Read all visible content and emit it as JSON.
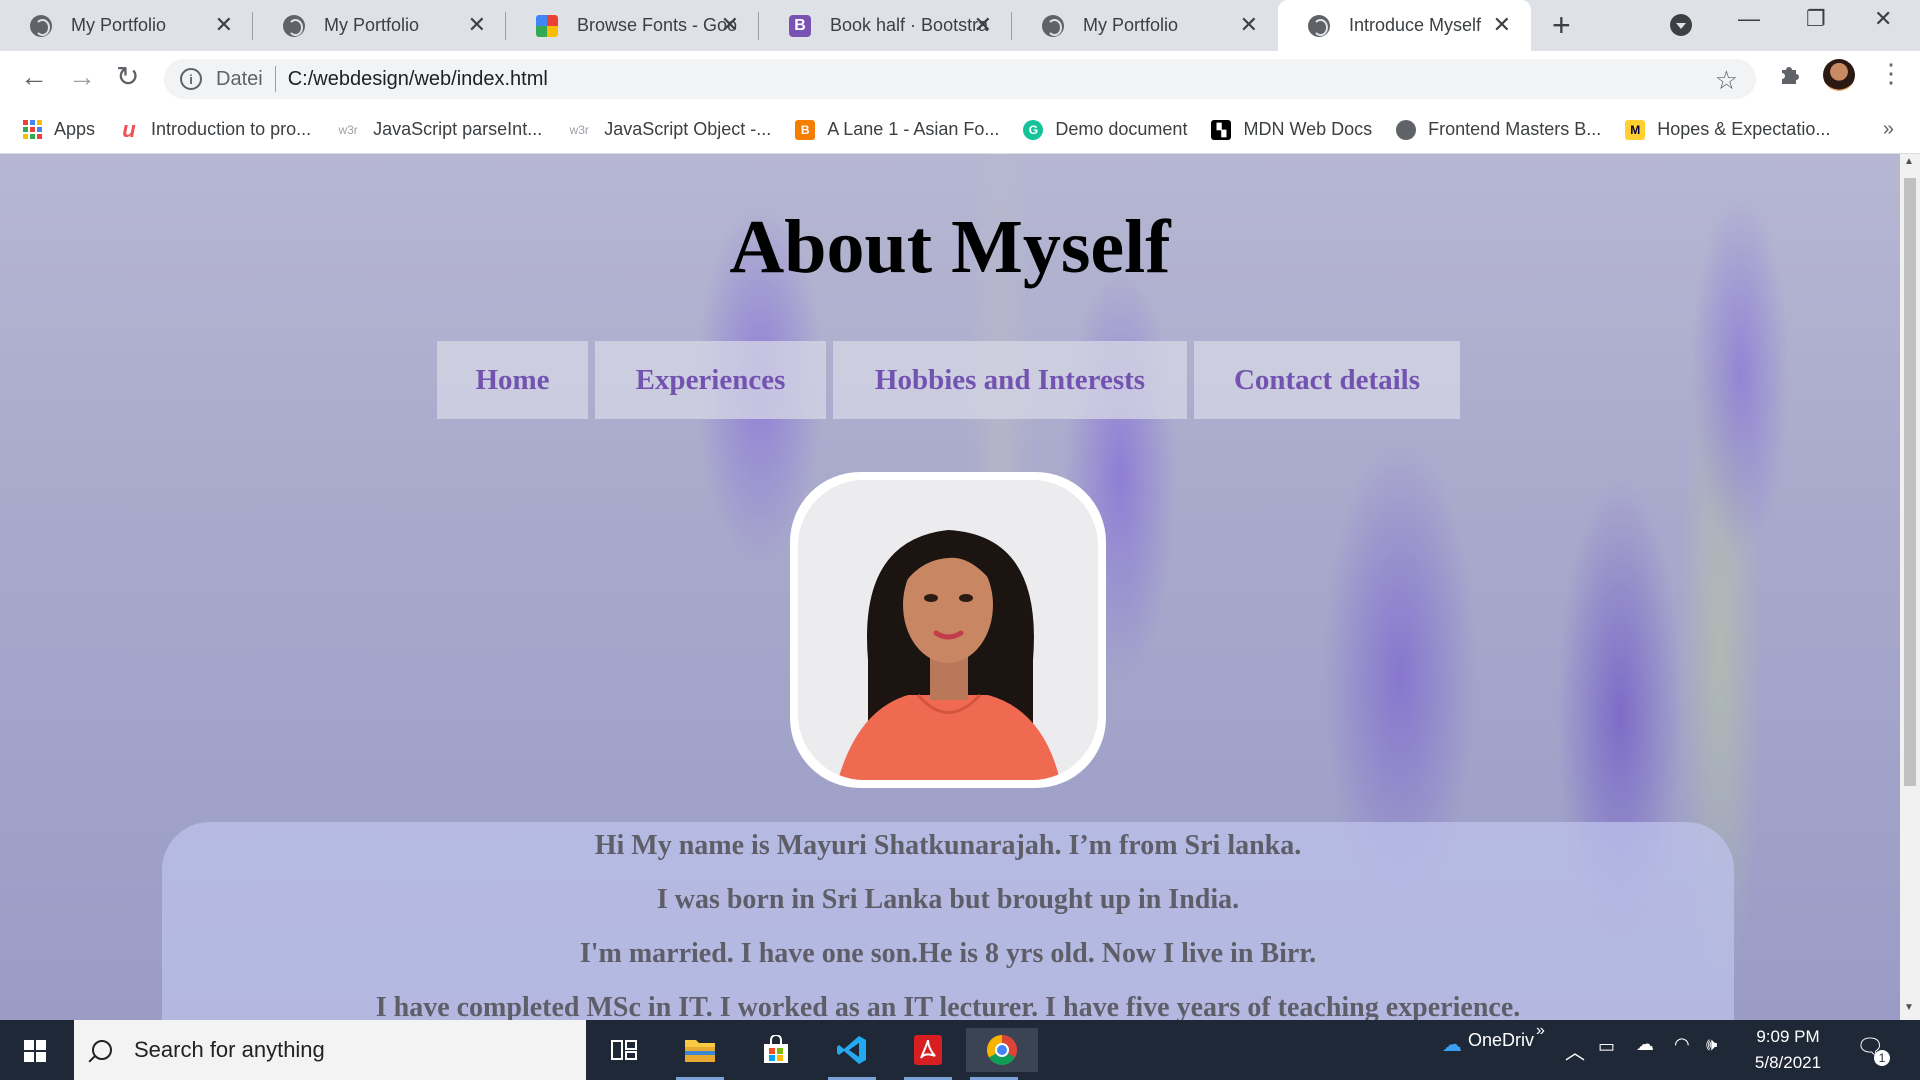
{
  "browser": {
    "tabs": [
      {
        "title": "My Portfolio",
        "icon": "globe-icon"
      },
      {
        "title": "My Portfolio",
        "icon": "globe-icon"
      },
      {
        "title": "Browse Fonts - Goo",
        "icon": "google-fonts-icon"
      },
      {
        "title": "Book half · Bootstra",
        "icon": "bootstrap-icon"
      },
      {
        "title": "My Portfolio",
        "icon": "globe-icon"
      },
      {
        "title": "Introduce Myself",
        "icon": "globe-icon",
        "active": true
      }
    ],
    "new_tab": "+",
    "window": {
      "minimize": "—",
      "restore": "❐",
      "close": "✕"
    },
    "toolbar": {
      "back": "←",
      "forward": "→",
      "reload": "↻",
      "origin_label": "Datei",
      "url": "C:/webdesign/web/index.html",
      "star": "☆",
      "menu": "⋮"
    },
    "bookmarks": [
      {
        "label": "Apps",
        "icon": "apps-grid-icon",
        "color": "#4285f4"
      },
      {
        "label": "Introduction to pro...",
        "icon": "udemy-icon",
        "color": "#ec5252"
      },
      {
        "label": "JavaScript parseInt...",
        "icon": "w3schools-icon",
        "color": "#9aa0a6",
        "glyph": "w3r"
      },
      {
        "label": "JavaScript Object -...",
        "icon": "w3schools-icon",
        "color": "#9aa0a6",
        "glyph": "w3r"
      },
      {
        "label": "A Lane 1 - Asian Fo...",
        "icon": "blogger-icon",
        "color": "#f57d00"
      },
      {
        "label": "Demo document",
        "icon": "grammarly-icon",
        "color": "#15c39a",
        "glyph": "G"
      },
      {
        "label": "MDN Web Docs",
        "icon": "mdn-icon",
        "color": "#000000"
      },
      {
        "label": "Frontend Masters B...",
        "icon": "globe-icon",
        "color": "#5f6368"
      },
      {
        "label": "Hopes & Expectatio...",
        "icon": "miro-icon",
        "color": "#ffd02f"
      }
    ],
    "bookmarks_overflow": "»"
  },
  "page": {
    "title": "About Myself",
    "nav": [
      "Home",
      "Experiences",
      "Hobbies and Interests",
      "Contact details"
    ],
    "about_lines": [
      "Hi My name is Mayuri Shatkunarajah. I’m from Sri lanka.",
      "I was born in Sri Lanka but brought up in India.",
      "I'm married. I have one son.He is 8 yrs old. Now I live in Birr.",
      "I have completed MSc in IT. I worked as an IT lecturer. I have five years of teaching experience."
    ]
  },
  "taskbar": {
    "search_placeholder": "Search for anything",
    "apps": [
      "task-view-icon",
      "file-explorer-icon",
      "microsoft-store-icon",
      "vscode-icon",
      "acrobat-icon",
      "chrome-icon"
    ],
    "onedrive_label": "OneDriv",
    "tray_overflow": "»",
    "time": "9:09 PM",
    "date": "5/8/2021",
    "notification_count": "1"
  },
  "colors": {
    "nav_link_text": "#7353b0",
    "about_text": "#5e5e68",
    "taskbar_bg": "#1f2836"
  }
}
